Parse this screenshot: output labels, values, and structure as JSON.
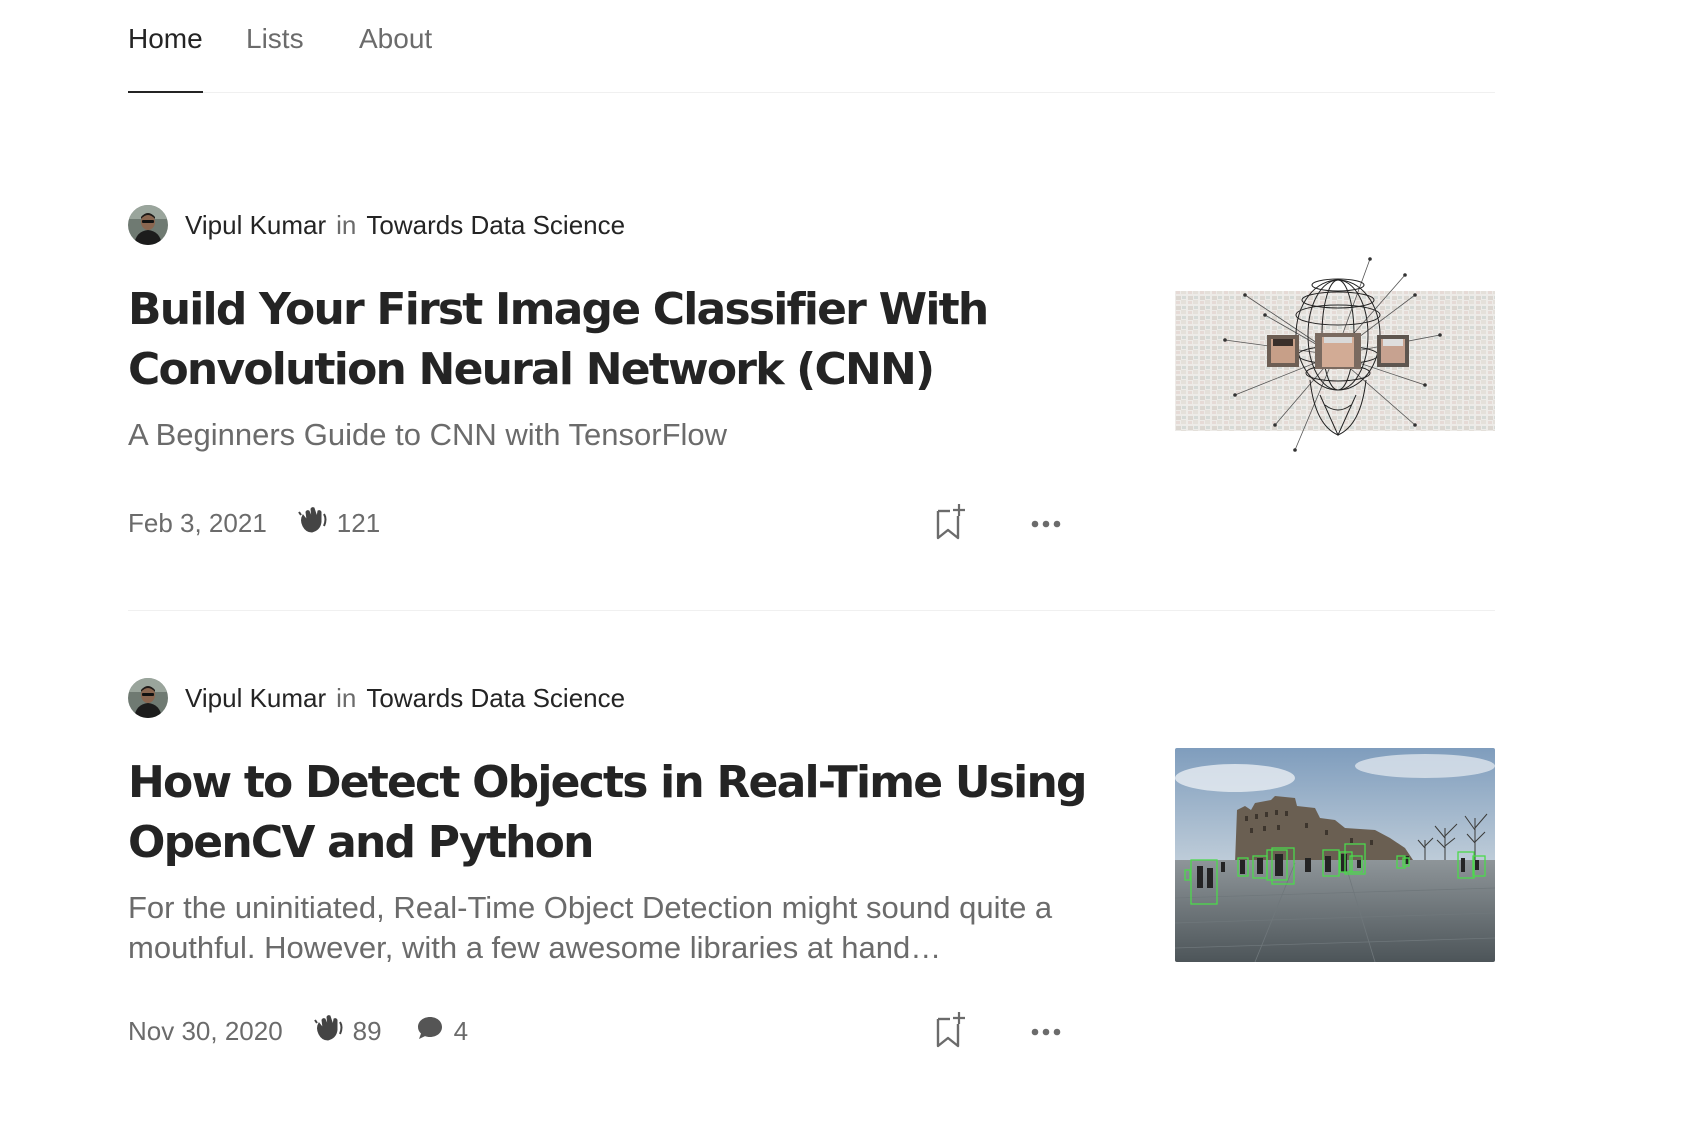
{
  "tabs": [
    {
      "label": "Home",
      "active": true
    },
    {
      "label": "Lists",
      "active": false
    },
    {
      "label": "About",
      "active": false
    }
  ],
  "articles": [
    {
      "author": "Vipul Kumar",
      "in_word": "in",
      "publication": "Towards Data Science",
      "title": "Build Your First Image Classifier With Convolution Neural Network (CNN)",
      "subtitle": "A Beginners Guide to CNN with TensorFlow",
      "date": "Feb 3, 2021",
      "claps": "121",
      "thumbnail_icon": "cnn-wireframe-head-image"
    },
    {
      "author": "Vipul Kumar",
      "in_word": "in",
      "publication": "Towards Data Science",
      "title": "How to Detect Objects in Real-Time Using OpenCV and Python",
      "subtitle": "For the uninitiated, Real-Time Object Detection might sound quite a mouthful. However, with a few awesome libraries at hand…",
      "date": "Nov 30, 2020",
      "claps": "89",
      "responses": "4",
      "thumbnail_icon": "castle-object-detection-image"
    }
  ],
  "colors": {
    "text_primary": "#242424",
    "text_secondary": "#6b6b6b",
    "divider": "#f0f0f0",
    "detection_box": "#4cd94c"
  }
}
